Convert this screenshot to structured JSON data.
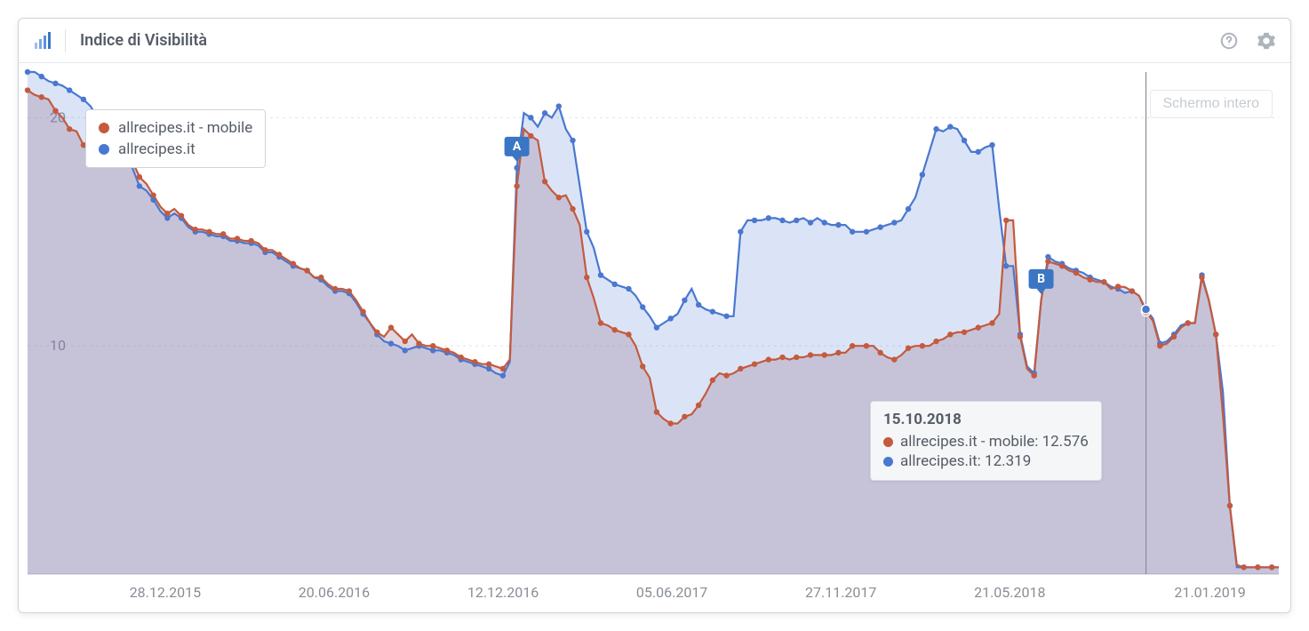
{
  "header": {
    "title": "Indice di Visibilità"
  },
  "fullscreen_label": "Schermo intero",
  "legend": {
    "series1": "allrecipes.it - mobile",
    "series2": "allrecipes.it"
  },
  "tooltip": {
    "date": "15.10.2018",
    "row1": "allrecipes.it - mobile: 12.576",
    "row2": "allrecipes.it: 12.319"
  },
  "axes": {
    "y_ticks": [
      "20",
      "10"
    ],
    "x_ticks": [
      "28.12.2015",
      "20.06.2016",
      "12.12.2016",
      "05.06.2017",
      "27.11.2017",
      "21.05.2018",
      "21.01.2019"
    ]
  },
  "colors": {
    "mobile": "#c45a3e",
    "desktop": "#4a78d0"
  },
  "chart_data": {
    "type": "line",
    "title": "Indice di Visibilità",
    "xlabel": "",
    "ylabel": "",
    "ylim": [
      0,
      22
    ],
    "x_dates_ticks": [
      "28.12.2015",
      "20.06.2016",
      "12.12.2016",
      "05.06.2017",
      "27.11.2017",
      "21.05.2018",
      "21.01.2019"
    ],
    "markers": [
      {
        "label": "A",
        "x_index": 70
      },
      {
        "label": "B",
        "x_index": 145
      }
    ],
    "crosshair": {
      "x_index": 160,
      "date": "15.10.2018"
    },
    "series": [
      {
        "name": "allrecipes.it - mobile",
        "color": "#c45a3e",
        "values": [
          21.2,
          21.0,
          20.9,
          20.8,
          20.3,
          20.0,
          19.5,
          19.4,
          18.8,
          18.5,
          19.3,
          19.8,
          18.4,
          18.9,
          19.0,
          18.1,
          17.4,
          17.1,
          16.6,
          16.1,
          15.8,
          16.0,
          15.7,
          15.3,
          15.1,
          15.1,
          15.0,
          14.9,
          14.9,
          14.7,
          14.7,
          14.6,
          14.6,
          14.5,
          14.2,
          14.2,
          14.0,
          13.8,
          13.6,
          13.4,
          13.3,
          13.0,
          13.0,
          12.7,
          12.5,
          12.5,
          12.4,
          12.0,
          11.5,
          11.0,
          10.6,
          10.4,
          10.8,
          10.5,
          10.2,
          10.5,
          10.1,
          10.0,
          10.0,
          9.9,
          9.8,
          9.7,
          9.5,
          9.4,
          9.3,
          9.2,
          9.2,
          9.1,
          9.0,
          9.4,
          17.0,
          19.5,
          19.2,
          19.0,
          17.2,
          16.8,
          16.5,
          16.6,
          16.0,
          15.3,
          13.0,
          12.1,
          11.0,
          10.9,
          10.7,
          10.6,
          10.5,
          10.0,
          9.1,
          8.6,
          7.1,
          6.8,
          6.6,
          6.6,
          6.9,
          7.0,
          7.4,
          7.9,
          8.5,
          8.8,
          8.7,
          8.8,
          9.0,
          9.1,
          9.2,
          9.3,
          9.4,
          9.4,
          9.5,
          9.4,
          9.5,
          9.5,
          9.6,
          9.6,
          9.6,
          9.6,
          9.7,
          9.7,
          10.0,
          10.0,
          10.0,
          10.0,
          9.7,
          9.5,
          9.4,
          9.6,
          9.9,
          10.0,
          10.0,
          10.0,
          10.2,
          10.3,
          10.5,
          10.6,
          10.6,
          10.7,
          10.8,
          10.9,
          11.0,
          11.4,
          15.5,
          15.5,
          10.4,
          9.0,
          8.7,
          12.0,
          13.7,
          13.6,
          13.5,
          13.3,
          13.2,
          13.0,
          12.9,
          12.8,
          12.8,
          12.5,
          12.6,
          12.576,
          12.4,
          12.2,
          11.5,
          11.1,
          10.0,
          10.1,
          10.4,
          10.8,
          11.0,
          11.0,
          13.0,
          12.0,
          10.5,
          7.0,
          3.0,
          0.4,
          0.3,
          0.3,
          0.3,
          0.3,
          0.3,
          0.3
        ]
      },
      {
        "name": "allrecipes.it",
        "color": "#4a78d0",
        "values": [
          22.0,
          22.0,
          21.8,
          21.6,
          21.5,
          21.4,
          21.2,
          21.0,
          20.8,
          20.5,
          20.0,
          19.6,
          19.4,
          18.8,
          19.1,
          17.8,
          17.0,
          16.8,
          16.4,
          15.9,
          15.6,
          15.8,
          15.6,
          15.2,
          15.0,
          15.0,
          14.9,
          14.8,
          14.8,
          14.6,
          14.6,
          14.5,
          14.5,
          14.4,
          14.1,
          14.1,
          13.9,
          13.7,
          13.5,
          13.4,
          13.3,
          13.0,
          12.9,
          12.6,
          12.4,
          12.4,
          12.3,
          11.9,
          11.4,
          11.0,
          10.5,
          10.2,
          10.1,
          10.0,
          9.8,
          9.9,
          10.0,
          9.9,
          9.8,
          9.8,
          9.7,
          9.6,
          9.4,
          9.3,
          9.2,
          9.1,
          9.0,
          8.8,
          8.7,
          9.3,
          17.8,
          20.2,
          20.0,
          19.6,
          20.2,
          20.0,
          20.5,
          19.5,
          19.0,
          17.0,
          15.0,
          14.3,
          13.1,
          12.9,
          12.7,
          12.6,
          12.5,
          12.2,
          11.7,
          11.3,
          10.8,
          11.0,
          11.2,
          11.4,
          12.0,
          12.5,
          11.8,
          11.6,
          11.5,
          11.4,
          11.3,
          11.3,
          15.0,
          15.5,
          15.5,
          15.5,
          15.6,
          15.6,
          15.5,
          15.4,
          15.5,
          15.6,
          15.4,
          15.6,
          15.4,
          15.3,
          15.3,
          15.3,
          15.0,
          15.0,
          15.0,
          15.1,
          15.2,
          15.3,
          15.4,
          15.5,
          16.0,
          16.5,
          17.5,
          18.5,
          19.5,
          19.4,
          19.6,
          19.5,
          19.0,
          18.5,
          18.5,
          18.7,
          18.8,
          16.0,
          13.5,
          13.5,
          10.5,
          9.1,
          8.8,
          12.0,
          13.9,
          13.7,
          13.6,
          13.4,
          13.3,
          13.2,
          13.0,
          12.9,
          12.8,
          12.6,
          12.5,
          12.319,
          12.4,
          12.2,
          11.6,
          11.2,
          10.1,
          10.2,
          10.5,
          10.9,
          11.0,
          11.0,
          13.1,
          12.0,
          10.5,
          8.0,
          3.0,
          0.3,
          0.3,
          0.3,
          0.3,
          0.3,
          0.3,
          0.3
        ]
      }
    ]
  }
}
